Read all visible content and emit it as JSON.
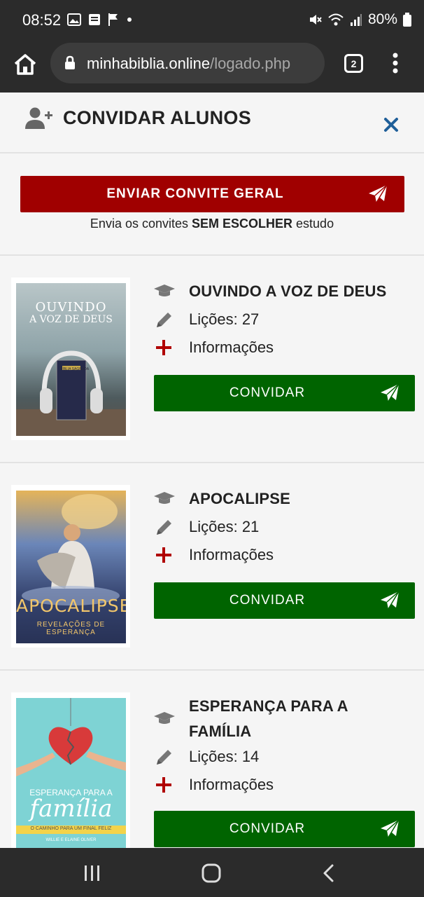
{
  "status_bar": {
    "time": "08:52",
    "battery": "80%"
  },
  "browser": {
    "url_domain": "minhabiblia.online",
    "url_path": "/logado.php",
    "tab_count": "2"
  },
  "modal": {
    "title": "CONVIDAR ALUNOS"
  },
  "general_invite": {
    "button_label": "ENVIAR CONVITE GERAL",
    "note_prefix": "Envia os convites ",
    "note_bold": "SEM ESCOLHER",
    "note_suffix": " estudo"
  },
  "studies": [
    {
      "title": "OUVINDO A VOZ DE DEUS",
      "lessons": "Lições: 27",
      "info": "Informações",
      "invite_label": "CONVIDAR",
      "cover": {
        "line1": "OUVINDO",
        "line2": "A VOZ DE DEUS",
        "bible": "BÍBLIA SAGRADA"
      }
    },
    {
      "title": "APOCALIPSE",
      "lessons": "Lições: 21",
      "info": "Informações",
      "invite_label": "CONVIDAR",
      "cover": {
        "line1": "APOCALIPSE",
        "line2": "REVELAÇÕES DE ESPERANÇA"
      }
    },
    {
      "title_line1": "ESPERANÇA PARA A",
      "title_line2": "FAMÍLIA",
      "lessons": "Lições: 14",
      "info": "Informações",
      "invite_label": "CONVIDAR",
      "cover": {
        "line1": "ESPERANÇA PARA A",
        "line2": "família",
        "line3": "O CAMINHO PARA UM FINAL FELIZ",
        "authors": "WILLIE E ELAINE OLIVER"
      }
    }
  ],
  "colors": {
    "primary_red": "#a00000",
    "primary_green": "#006400",
    "accent_blue": "#1f5f99",
    "dark_bar": "#2b2b2b"
  }
}
